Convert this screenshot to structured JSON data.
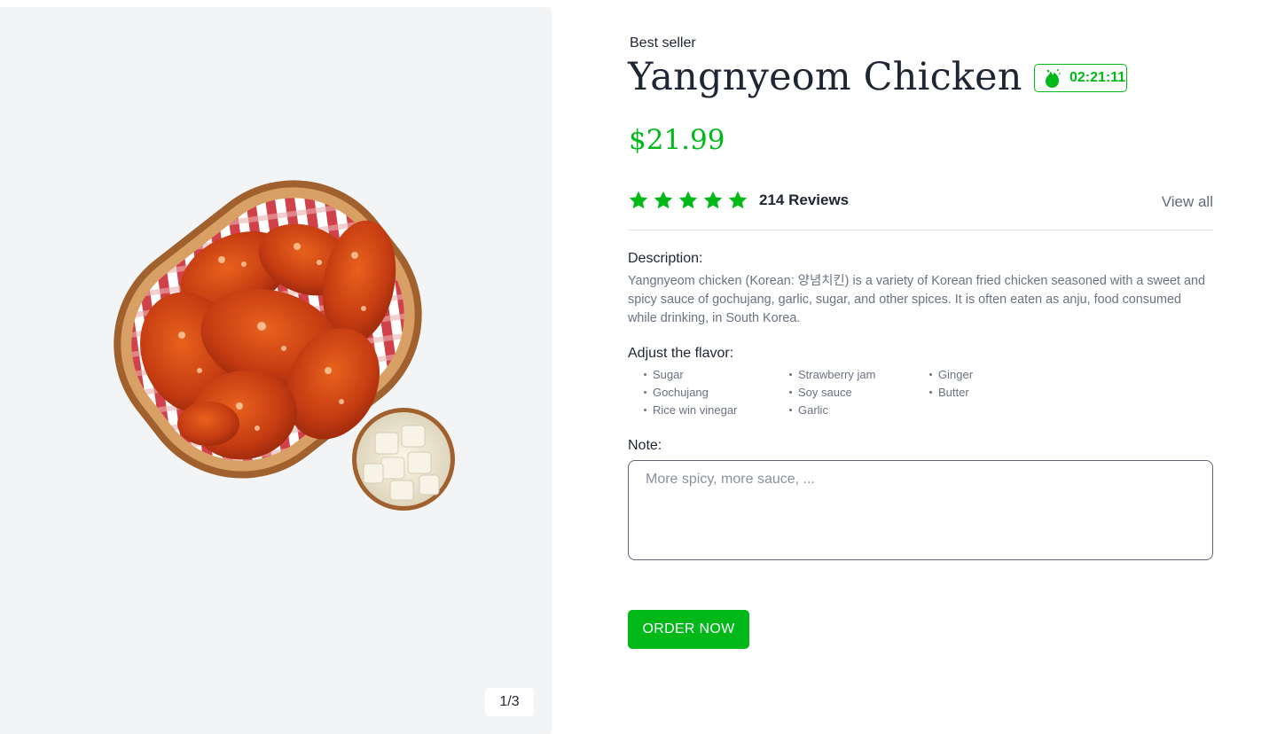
{
  "gallery": {
    "counter": "1/3",
    "image_alt": "Yangnyeom chicken in a basket with pickled radish"
  },
  "product": {
    "eyebrow": "Best seller",
    "title": "Yangnyeom Chicken",
    "timer": "02:21:11",
    "price": "$21.99",
    "rating": {
      "stars": 5,
      "max": 5
    },
    "reviews": "214 Reviews",
    "view_all": "View all"
  },
  "description": {
    "label": "Description:",
    "text": "Yangnyeom chicken (Korean: 양념치킨) is a variety of Korean fried chicken seasoned with a sweet and spicy sauce of gochujang, garlic, sugar, and other spices. It is often eaten as anju, food consumed while drinking, in South Korea."
  },
  "flavor": {
    "label": "Adjust the flavor:",
    "items": [
      "Sugar",
      "Gochujang",
      "Rice win vinegar",
      "Strawberry jam",
      "Soy sauce",
      "Garlic",
      "Ginger",
      "Butter"
    ]
  },
  "note": {
    "label": "Note:",
    "value": "",
    "placeholder": "More spicy, more sauce, ..."
  },
  "actions": {
    "order": "ORDER NOW"
  },
  "colors": {
    "accent": "#00b818",
    "gallery_bg": "#f3f4f6",
    "text": "#1f2533",
    "muted": "#6b7280"
  },
  "icons": {
    "timer": "fire-icon",
    "rating": "star-icon"
  }
}
